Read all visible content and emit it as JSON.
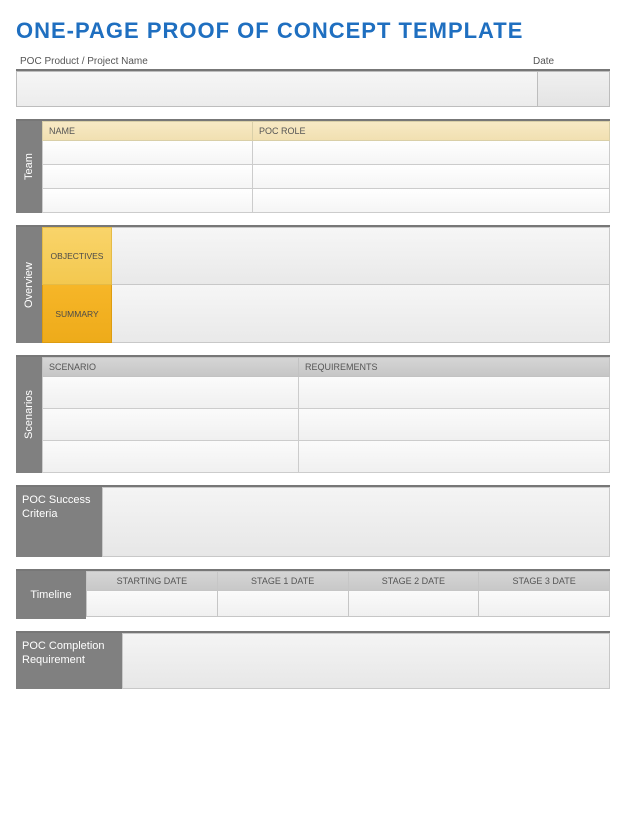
{
  "title": "ONE-PAGE PROOF OF CONCEPT TEMPLATE",
  "header": {
    "name_label": "POC Product / Project Name",
    "date_label": "Date",
    "name_value": "",
    "date_value": ""
  },
  "team": {
    "tab": "Team",
    "col_name": "NAME",
    "col_role": "POC ROLE",
    "rows": [
      {
        "name": "",
        "role": ""
      },
      {
        "name": "",
        "role": ""
      },
      {
        "name": "",
        "role": ""
      }
    ]
  },
  "overview": {
    "tab": "Overview",
    "objectives_label": "OBJECTIVES",
    "summary_label": "SUMMARY",
    "objectives_value": "",
    "summary_value": ""
  },
  "scenarios": {
    "tab": "Scenarios",
    "col_scenario": "SCENARIO",
    "col_requirements": "REQUIREMENTS",
    "rows": [
      {
        "scenario": "",
        "requirements": ""
      },
      {
        "scenario": "",
        "requirements": ""
      },
      {
        "scenario": "",
        "requirements": ""
      }
    ]
  },
  "success": {
    "tab": "POC Success Criteria",
    "value": ""
  },
  "timeline": {
    "tab": "Timeline",
    "cols": [
      "STARTING DATE",
      "STAGE 1 DATE",
      "STAGE 2 DATE",
      "STAGE 3 DATE"
    ],
    "values": [
      "",
      "",
      "",
      ""
    ]
  },
  "completion": {
    "tab": "POC Completion Requirement",
    "value": ""
  }
}
